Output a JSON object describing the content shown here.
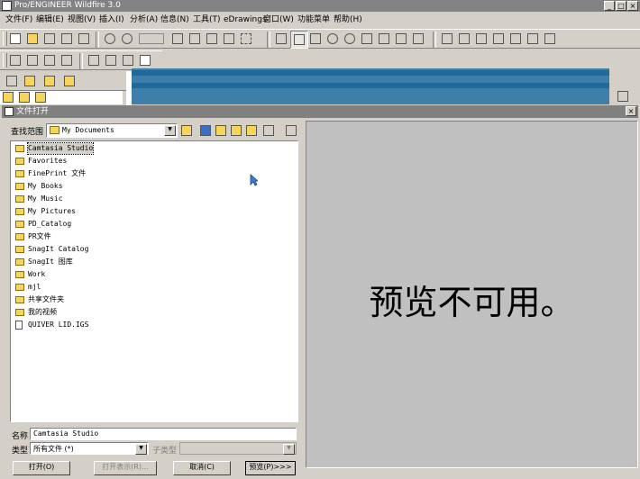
{
  "app": {
    "title": "Pro/ENGINEER Wildfire 3.0",
    "window_buttons": [
      "_",
      "□",
      "×"
    ]
  },
  "menu": [
    "文件(F)",
    "编辑(E)",
    "视图(V)",
    "插入(I)",
    "分析(A)",
    "信息(N)",
    "工具(T)",
    "eDrawings",
    "窗口(W)",
    "功能菜单",
    "帮助(H)"
  ],
  "dialog": {
    "title": "文件打开",
    "lookin_label": "查找范围",
    "lookin_value": "My Documents",
    "files": [
      {
        "name": "Camtasia Studio",
        "type": "folder",
        "selected": true
      },
      {
        "name": "Favorites",
        "type": "folder"
      },
      {
        "name": "FinePrint 文件",
        "type": "folder"
      },
      {
        "name": "My Books",
        "type": "folder"
      },
      {
        "name": "My Music",
        "type": "folder"
      },
      {
        "name": "My Pictures",
        "type": "folder"
      },
      {
        "name": "PD_Catalog",
        "type": "folder"
      },
      {
        "name": "PR文件",
        "type": "folder"
      },
      {
        "name": "SnagIt Catalog",
        "type": "folder"
      },
      {
        "name": "SnagIt 图库",
        "type": "folder"
      },
      {
        "name": "Work",
        "type": "folder"
      },
      {
        "name": "mjl",
        "type": "folder"
      },
      {
        "name": "共享文件夹",
        "type": "folder"
      },
      {
        "name": "我的视频",
        "type": "folder"
      },
      {
        "name": "QUIVER LID.IGS",
        "type": "file"
      }
    ],
    "name_label": "名称",
    "name_value": "Camtasia Studio",
    "type_label": "类型",
    "type_value": "所有文件 (*)",
    "subtype_label": "子类型",
    "buttons": {
      "open": "打开(O)",
      "open_rep": "打开表示(R)...",
      "cancel": "取消(C)",
      "preview": "预览(P)>>>"
    },
    "preview_text": "预览不可用。"
  }
}
